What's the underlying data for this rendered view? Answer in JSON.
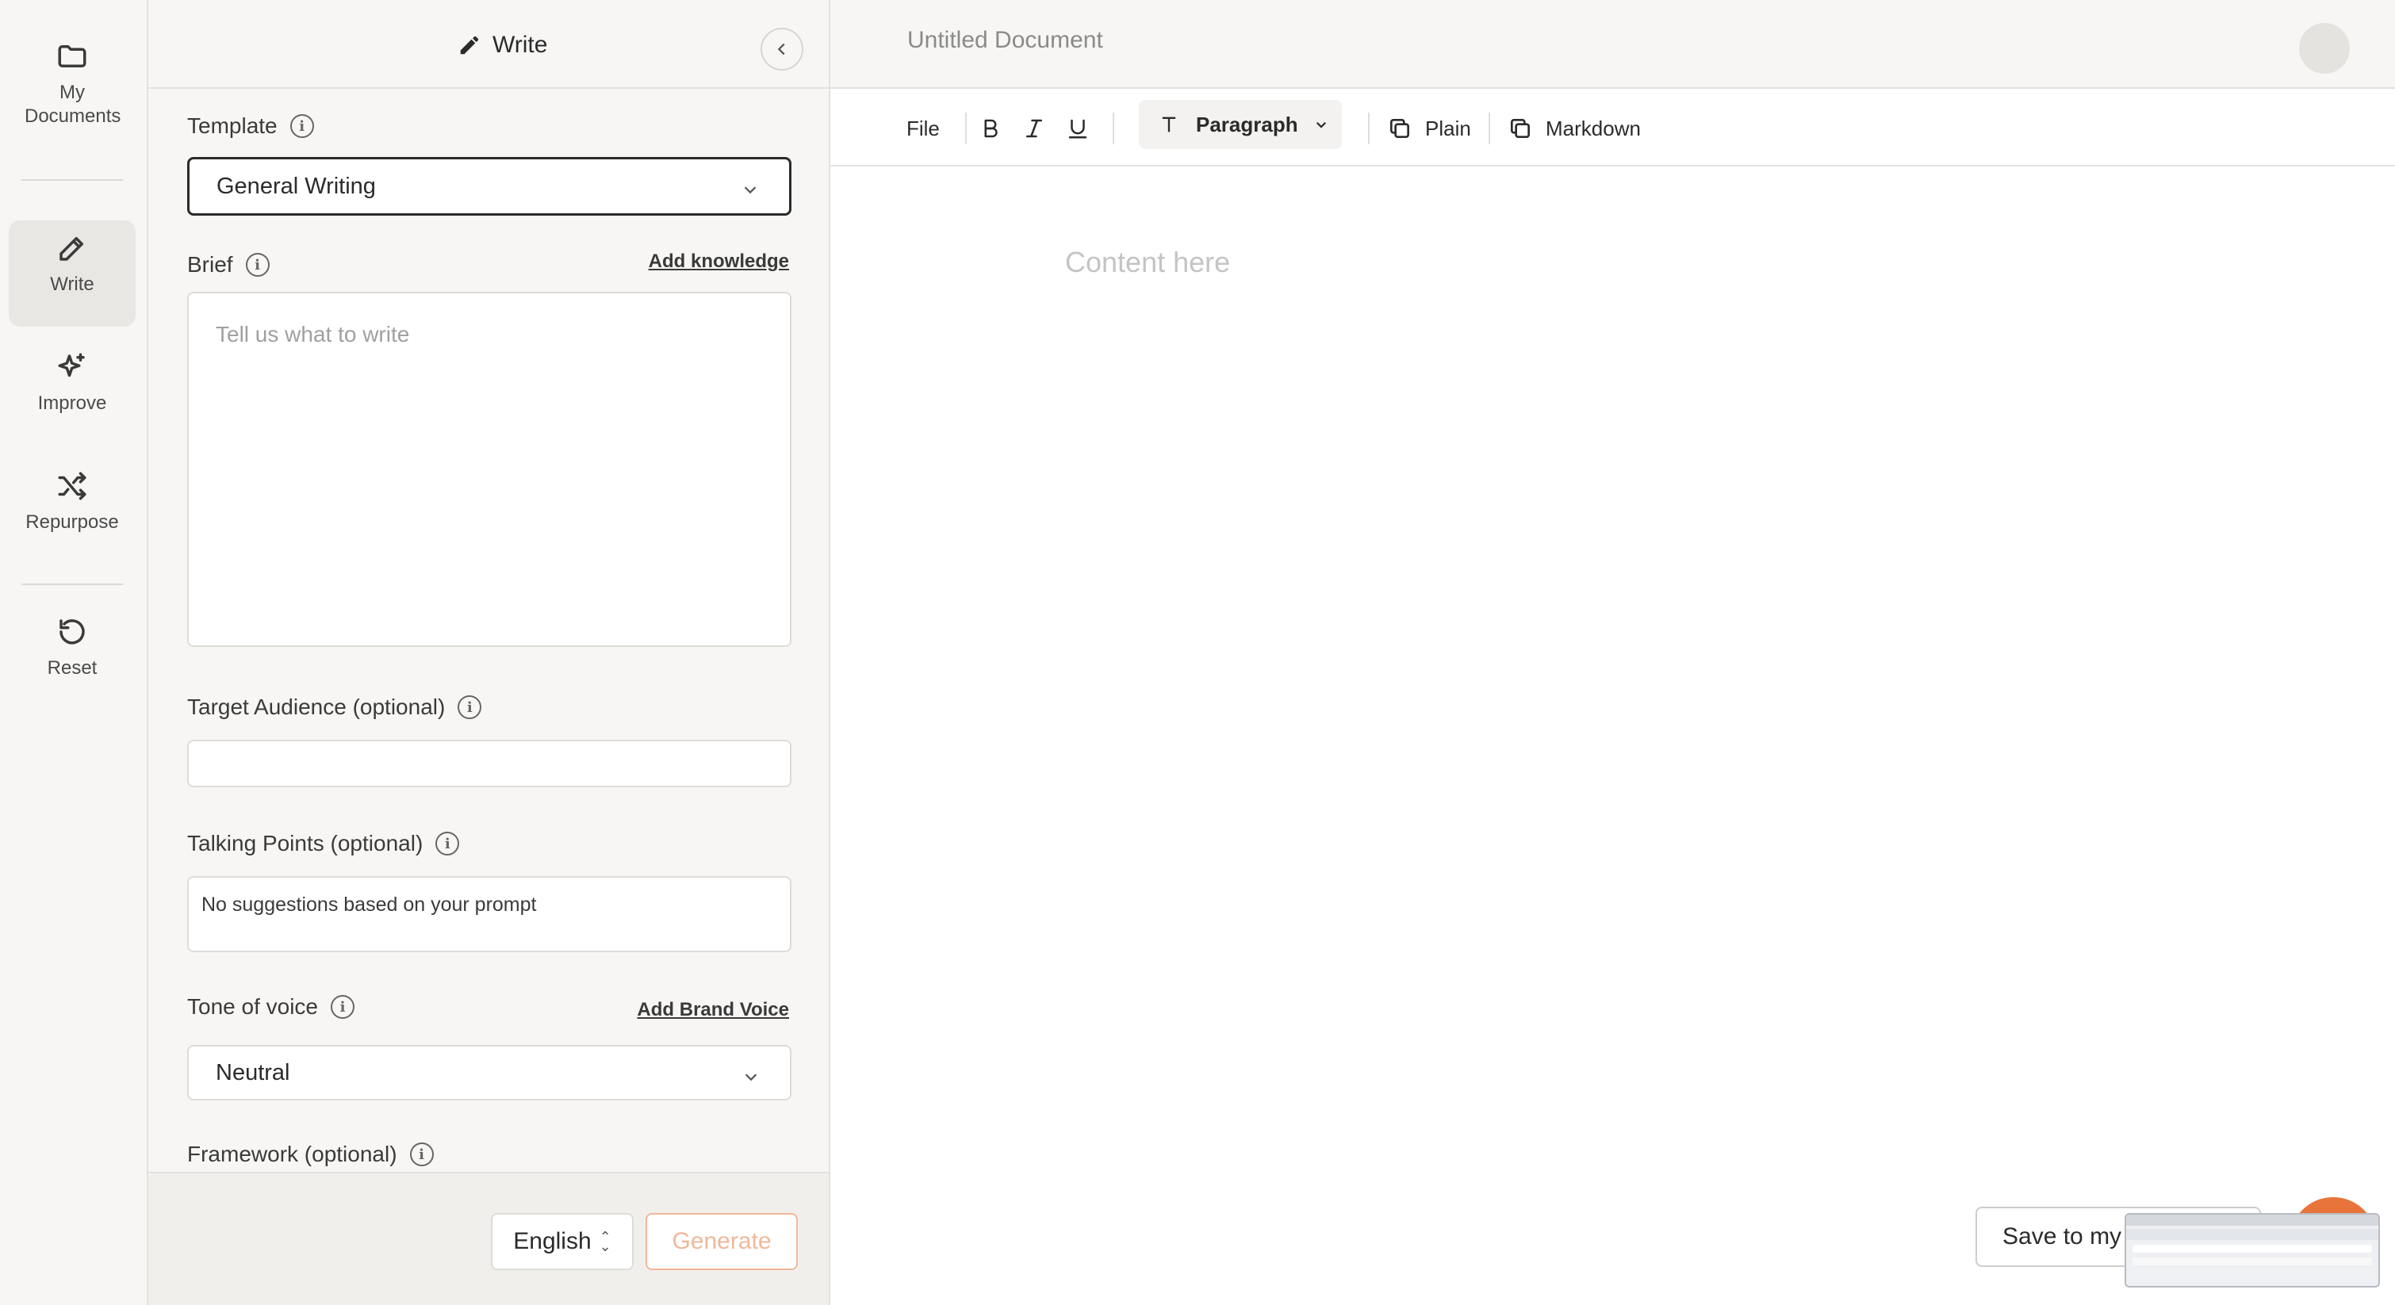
{
  "rail": {
    "items": [
      {
        "label": "My Documents",
        "icon": "folder-icon"
      },
      {
        "label": "Write",
        "icon": "pencil-icon"
      },
      {
        "label": "Improve",
        "icon": "sparkles-icon"
      },
      {
        "label": "Repurpose",
        "icon": "shuffle-icon"
      },
      {
        "label": "Reset",
        "icon": "reset-icon"
      }
    ]
  },
  "panel": {
    "title": "Write",
    "template": {
      "label": "Template",
      "value": "General Writing"
    },
    "brief": {
      "label": "Brief",
      "link": "Add knowledge",
      "placeholder": "Tell us what to write"
    },
    "audience": {
      "label": "Target Audience (optional)",
      "value": ""
    },
    "talking_points": {
      "label": "Talking Points (optional)",
      "value": "No suggestions based on your prompt"
    },
    "tone": {
      "label": "Tone of voice",
      "link": "Add Brand Voice",
      "value": "Neutral"
    },
    "framework": {
      "label": "Framework (optional)"
    },
    "footer": {
      "language": "English",
      "generate": "Generate"
    }
  },
  "editor": {
    "doc_title": "Untitled Document",
    "toolbar": {
      "file": "File",
      "paragraph": "Paragraph",
      "plain": "Plain",
      "markdown": "Markdown"
    },
    "placeholder": "Content here",
    "save_button": "Save to my"
  },
  "colors": {
    "accent": "#e8743b",
    "generate_disabled": "#f0b89a"
  }
}
